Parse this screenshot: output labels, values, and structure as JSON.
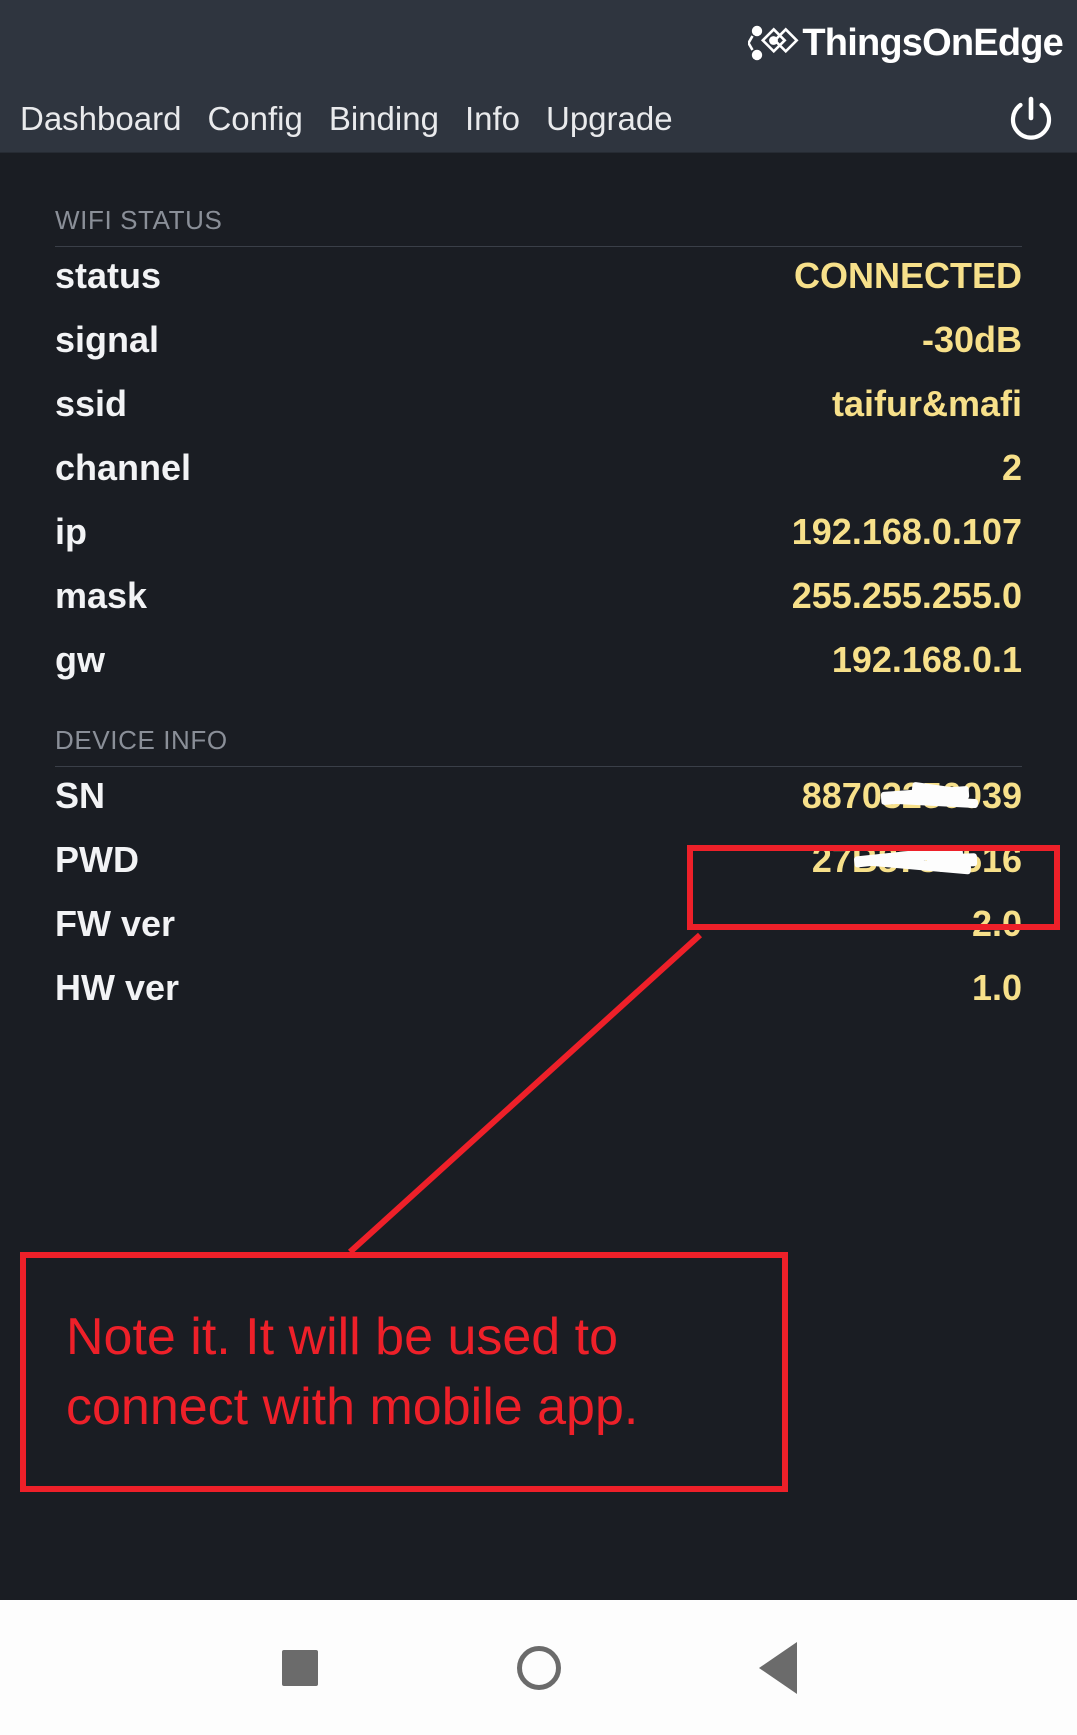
{
  "app": {
    "brand_name": "ThingsOnEdge",
    "logo_icon": "thingsonedge-nodes-logo"
  },
  "nav": {
    "items": [
      {
        "label": "Dashboard"
      },
      {
        "label": "Config"
      },
      {
        "label": "Binding"
      },
      {
        "label": "Info"
      },
      {
        "label": "Upgrade"
      }
    ],
    "power_icon": "power-icon"
  },
  "sections": [
    {
      "title": "WIFI STATUS",
      "rows": [
        {
          "key": "status",
          "value": "CONNECTED"
        },
        {
          "key": "signal",
          "value": "-30dB"
        },
        {
          "key": "ssid",
          "value": "taifur&mafi"
        },
        {
          "key": "channel",
          "value": "2"
        },
        {
          "key": "ip",
          "value": "192.168.0.107"
        },
        {
          "key": "mask",
          "value": "255.255.255.0"
        },
        {
          "key": "gw",
          "value": "192.168.0.1"
        }
      ]
    },
    {
      "title": "DEVICE INFO",
      "rows": [
        {
          "key": "SN",
          "value": "88703250039"
        },
        {
          "key": "PWD",
          "value": "27B873E516"
        },
        {
          "key": "FW ver",
          "value": "2.0"
        },
        {
          "key": "HW ver",
          "value": "1.0"
        }
      ]
    }
  ],
  "annotation": {
    "note_line_1": "Note it. It will be used to",
    "note_line_2": "connect with mobile app.",
    "highlight_color": "#ee2029"
  },
  "system_nav": {
    "recents_icon": "square-recents-icon",
    "home_icon": "circle-home-icon",
    "back_icon": "triangle-back-icon"
  },
  "colors": {
    "background": "#1a1d23",
    "header": "#2f353f",
    "value_yellow": "#f7e08a",
    "key_white": "#f2f3f5",
    "section_label": "#8a8f98"
  }
}
